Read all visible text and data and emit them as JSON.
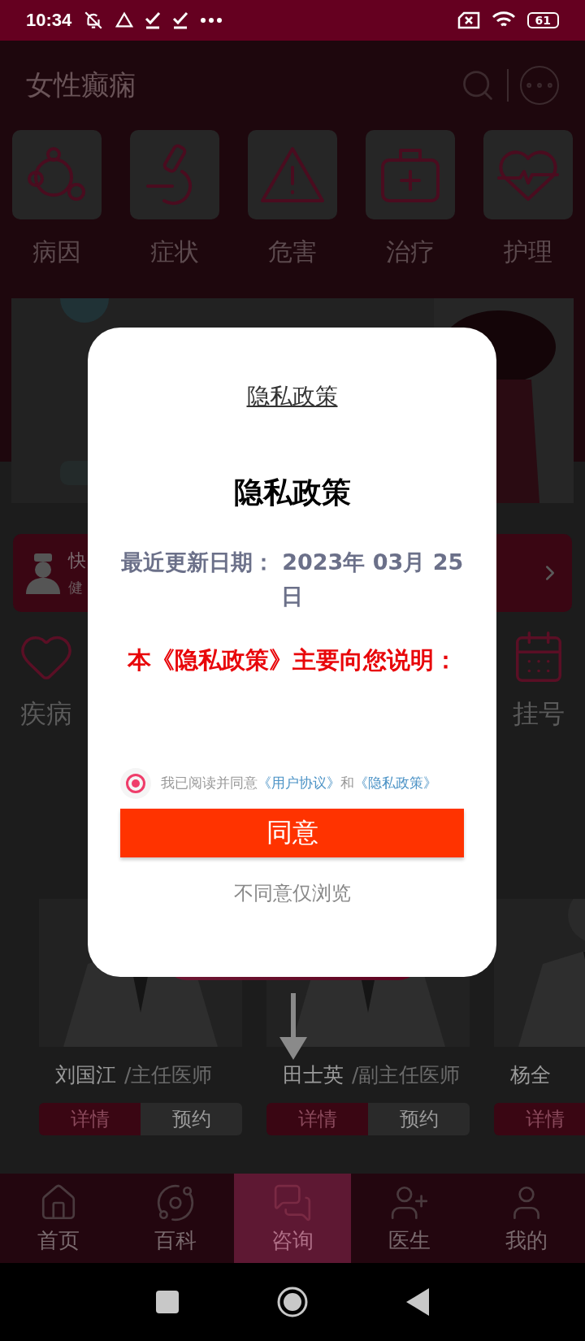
{
  "status_bar": {
    "time": "10:34",
    "battery": "61"
  },
  "header": {
    "title": "女性癫痫"
  },
  "categories": [
    {
      "label": "病因"
    },
    {
      "label": "症状"
    },
    {
      "label": "危害"
    },
    {
      "label": "治疗"
    },
    {
      "label": "护理"
    }
  ],
  "quick_card": {
    "title": "快",
    "subtitle": "健"
  },
  "shortcuts": [
    {
      "label": "疾病"
    },
    {
      "label": "挂号"
    }
  ],
  "doctors": [
    {
      "name": "刘国江",
      "title": "/主任医师",
      "details": "详情",
      "book": "预约"
    },
    {
      "name": "田士英",
      "title": "/副主任医师",
      "details": "详情",
      "book": "预约"
    },
    {
      "name": "杨全",
      "details": "详情"
    }
  ],
  "tabs": [
    {
      "label": "首页",
      "selected": false
    },
    {
      "label": "百科",
      "selected": false
    },
    {
      "label": "咨询",
      "selected": true
    },
    {
      "label": "医生",
      "selected": false
    },
    {
      "label": "我的",
      "selected": false
    }
  ],
  "dialog": {
    "link_title": "隐私政策",
    "heading": "隐私政策",
    "updated": "最近更新日期：  2023年 03月 25日",
    "intro": "本《隐私政策》主要向您说明：",
    "consent": {
      "checked": true,
      "before": "我已阅读并同意",
      "link_1": "《用户协议》",
      "middle": "和",
      "link_2": "《隐私政策》"
    },
    "agree": "同意",
    "decline": "不同意仅浏览"
  }
}
